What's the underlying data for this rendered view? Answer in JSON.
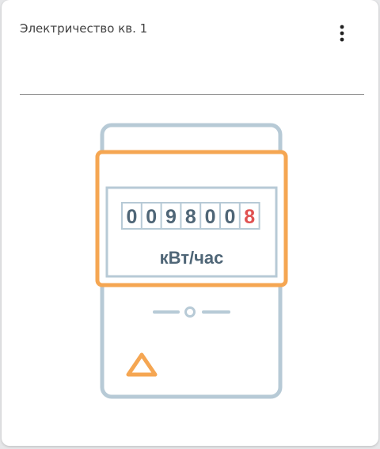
{
  "widget": {
    "title": "Электричество кв. 1",
    "menu_icon": "more-vert-icon"
  },
  "meter": {
    "digits": [
      "0",
      "0",
      "9",
      "8",
      "0",
      "0",
      "8"
    ],
    "unit": "кВт/час",
    "colors": {
      "body_outline": "#b7cad6",
      "display_frame": "#f5a652",
      "digit_text": "#4f6677",
      "last_digit": "#e05252",
      "unit_text": "#4f6677",
      "warning_triangle": "#f5a652"
    },
    "warning_icon": "warning-triangle-icon"
  }
}
